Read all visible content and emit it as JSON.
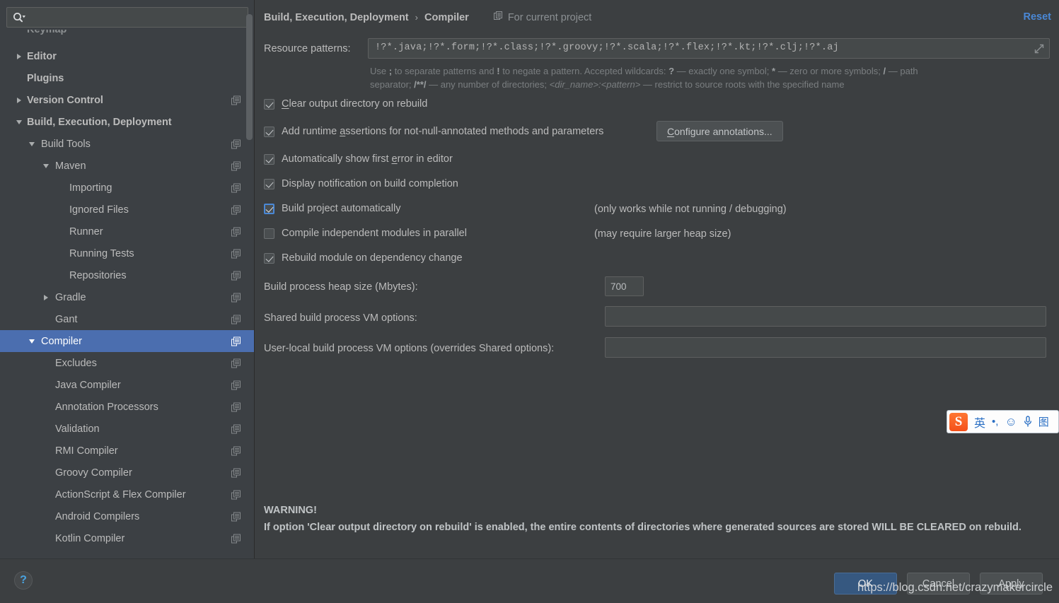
{
  "sidebar": {
    "search": {
      "placeholder": "",
      "value": "",
      "icon": "search-icon"
    },
    "tree": [
      {
        "label": "Keymap",
        "depth": 1,
        "arrow": "none",
        "bold": true,
        "cfg": false,
        "selected": false,
        "partial": true
      },
      {
        "label": "Editor",
        "depth": 1,
        "arrow": "right",
        "bold": true,
        "cfg": false,
        "selected": false
      },
      {
        "label": "Plugins",
        "depth": 1,
        "arrow": "none",
        "bold": true,
        "cfg": false,
        "selected": false
      },
      {
        "label": "Version Control",
        "depth": 1,
        "arrow": "right",
        "bold": true,
        "cfg": true,
        "selected": false
      },
      {
        "label": "Build, Execution, Deployment",
        "depth": 1,
        "arrow": "down",
        "bold": true,
        "cfg": false,
        "selected": false
      },
      {
        "label": "Build Tools",
        "depth": 2,
        "arrow": "down",
        "bold": false,
        "cfg": true,
        "selected": false
      },
      {
        "label": "Maven",
        "depth": 3,
        "arrow": "down",
        "bold": false,
        "cfg": true,
        "selected": false
      },
      {
        "label": "Importing",
        "depth": 4,
        "arrow": "none",
        "bold": false,
        "cfg": true,
        "selected": false
      },
      {
        "label": "Ignored Files",
        "depth": 4,
        "arrow": "none",
        "bold": false,
        "cfg": true,
        "selected": false
      },
      {
        "label": "Runner",
        "depth": 4,
        "arrow": "none",
        "bold": false,
        "cfg": true,
        "selected": false
      },
      {
        "label": "Running Tests",
        "depth": 4,
        "arrow": "none",
        "bold": false,
        "cfg": true,
        "selected": false
      },
      {
        "label": "Repositories",
        "depth": 4,
        "arrow": "none",
        "bold": false,
        "cfg": true,
        "selected": false
      },
      {
        "label": "Gradle",
        "depth": 3,
        "arrow": "right",
        "bold": false,
        "cfg": true,
        "selected": false
      },
      {
        "label": "Gant",
        "depth": 3,
        "arrow": "none",
        "bold": false,
        "cfg": true,
        "selected": false
      },
      {
        "label": "Compiler",
        "depth": 2,
        "arrow": "down",
        "bold": false,
        "cfg": true,
        "selected": true
      },
      {
        "label": "Excludes",
        "depth": 3,
        "arrow": "none",
        "bold": false,
        "cfg": true,
        "selected": false
      },
      {
        "label": "Java Compiler",
        "depth": 3,
        "arrow": "none",
        "bold": false,
        "cfg": true,
        "selected": false
      },
      {
        "label": "Annotation Processors",
        "depth": 3,
        "arrow": "none",
        "bold": false,
        "cfg": true,
        "selected": false
      },
      {
        "label": "Validation",
        "depth": 3,
        "arrow": "none",
        "bold": false,
        "cfg": true,
        "selected": false
      },
      {
        "label": "RMI Compiler",
        "depth": 3,
        "arrow": "none",
        "bold": false,
        "cfg": true,
        "selected": false
      },
      {
        "label": "Groovy Compiler",
        "depth": 3,
        "arrow": "none",
        "bold": false,
        "cfg": true,
        "selected": false
      },
      {
        "label": "ActionScript & Flex Compiler",
        "depth": 3,
        "arrow": "none",
        "bold": false,
        "cfg": true,
        "selected": false
      },
      {
        "label": "Android Compilers",
        "depth": 3,
        "arrow": "none",
        "bold": false,
        "cfg": true,
        "selected": false
      },
      {
        "label": "Kotlin Compiler",
        "depth": 3,
        "arrow": "none",
        "bold": false,
        "cfg": true,
        "selected": false
      }
    ]
  },
  "header": {
    "crumb1": "Build, Execution, Deployment",
    "separator": "›",
    "crumb2": "Compiler",
    "scope_label": "For current project",
    "scope_icon": "project-scope-icon",
    "reset_label": "Reset"
  },
  "resource_patterns": {
    "label": "Resource patterns:",
    "value": "!?*.java;!?*.form;!?*.class;!?*.groovy;!?*.scala;!?*.flex;!?*.kt;!?*.clj;!?*.aj",
    "expand_icon": "expand-icon",
    "help_line1_a": "Use ",
    "help_line1_semicolon": ";",
    "help_line1_b": " to separate patterns and ",
    "help_line1_bang": "!",
    "help_line1_c": " to negate a pattern. Accepted wildcards: ",
    "help_line1_q": "?",
    "help_line1_d": " — exactly one symbol; ",
    "help_line1_star": "*",
    "help_line1_e": " — zero or more symbols; ",
    "help_line1_slash": "/",
    "help_line1_f": " — path",
    "help_line2_a": "separator; ",
    "help_line2_globstar": "/**/",
    "help_line2_b": " — any number of directories; ",
    "help_line2_pattern": "<dir_name>:<pattern>",
    "help_line2_c": " — restrict to source roots with the specified name"
  },
  "options": [
    {
      "id": "clear-output-directory-on-rebuild",
      "pre": "C",
      "mnemonic": "",
      "text_before": "",
      "label_a": "C",
      "label_b": "lear output directory on rebuild",
      "checked": true,
      "focused": false,
      "note": ""
    },
    {
      "id": "add-runtime-assertions",
      "label_a": "Add runtime ",
      "mn": "a",
      "label_b": "ssertions for not-null-annotated methods and parameters",
      "checked": true,
      "focused": false,
      "note": ""
    },
    {
      "id": "automatically-show-first-error",
      "label_a": "Automatically show first ",
      "mn": "e",
      "label_b": "rror in editor",
      "checked": true,
      "focused": false,
      "note": ""
    },
    {
      "id": "display-notification-on-build-completion",
      "label_a": "Display notification on build completion",
      "mn": "",
      "label_b": "",
      "checked": true,
      "focused": false,
      "note": ""
    },
    {
      "id": "build-project-automatically",
      "label_a": "Build project automatically",
      "mn": "",
      "label_b": "",
      "checked": true,
      "focused": true,
      "note": "(only works while not running / debugging)"
    },
    {
      "id": "compile-independent-modules-in-parallel",
      "label_a": "Compile independent modules in parallel",
      "mn": "",
      "label_b": "",
      "checked": false,
      "focused": false,
      "note": "(may require larger heap size)"
    },
    {
      "id": "rebuild-module-on-dependency-change",
      "label_a": "Rebuild module on dependency change",
      "mn": "",
      "label_b": "",
      "checked": true,
      "focused": false,
      "note": ""
    }
  ],
  "configure_annotations": {
    "label_a": "C",
    "label_b": "onfigure annotations..."
  },
  "fields": {
    "heap_label": "Build process heap size (Mbytes):",
    "heap_value": "700",
    "shared_label": "Shared build process VM options:",
    "shared_value": "",
    "userlocal_label": "User-local build process VM options (overrides Shared options):",
    "userlocal_value": ""
  },
  "warning": {
    "title": "WARNING!",
    "body": "If option 'Clear output directory on rebuild' is enabled, the entire contents of directories where generated sources are stored WILL BE CLEARED on rebuild."
  },
  "buttons": {
    "help": "?",
    "ok": "OK",
    "cancel": "Cancel",
    "apply": "Apply"
  },
  "watermark": "https://blog.csdn.net/crazymakercircle",
  "ime": {
    "logo": "S",
    "mode": "英",
    "punct": "•,",
    "emoji": "☺",
    "mic": "🎙",
    "keyboard": "图"
  },
  "colors": {
    "background": "#3c3f41",
    "sidebar": "#3c4044",
    "selection": "#4b6eaf",
    "accent": "#4a88d6",
    "ok_button": "#365880",
    "text": "#bbbbbb"
  }
}
